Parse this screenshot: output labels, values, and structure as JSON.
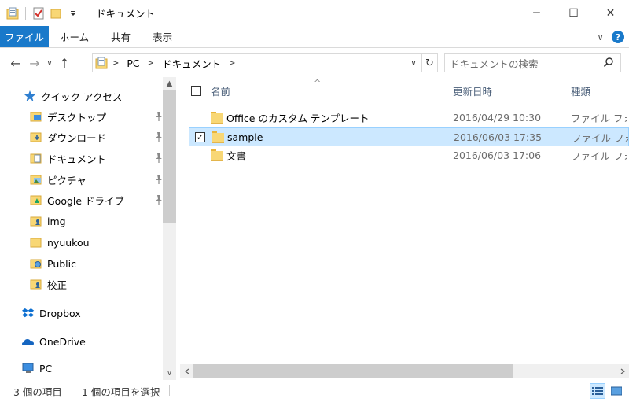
{
  "window": {
    "title": "ドキュメント",
    "minimize": "─",
    "maximize": "☐",
    "close": "✕"
  },
  "ribbon": {
    "tabs": [
      "ファイル",
      "ホーム",
      "共有",
      "表示"
    ],
    "expand": "∨",
    "help": "?"
  },
  "address": {
    "back": "←",
    "forward": "→",
    "recent": "∨",
    "up": "↑",
    "segments": [
      "PC",
      "ドキュメント"
    ],
    "separator": ">",
    "dropdown": "∨",
    "refresh": "↻"
  },
  "search": {
    "placeholder": "ドキュメントの検索"
  },
  "nav": {
    "quick_access": "クイック アクセス",
    "items": [
      {
        "label": "デスクトップ",
        "icon": "desktop-folder-icon",
        "pinned": true
      },
      {
        "label": "ダウンロード",
        "icon": "downloads-folder-icon",
        "pinned": true
      },
      {
        "label": "ドキュメント",
        "icon": "documents-folder-icon",
        "pinned": true
      },
      {
        "label": "ピクチャ",
        "icon": "pictures-folder-icon",
        "pinned": true
      },
      {
        "label": "Google ドライブ",
        "icon": "google-drive-folder-icon",
        "pinned": true
      },
      {
        "label": "img",
        "icon": "user-folder-icon",
        "pinned": false
      },
      {
        "label": "nyuukou",
        "icon": "folder-icon",
        "pinned": false
      },
      {
        "label": "Public",
        "icon": "public-folder-icon",
        "pinned": false
      },
      {
        "label": "校正",
        "icon": "user-folder-icon",
        "pinned": false
      }
    ],
    "dropbox": "Dropbox",
    "onedrive": "OneDrive",
    "pc": "PC",
    "scroll_up": "▲",
    "scroll_down": "∨"
  },
  "columns": {
    "name": "名前",
    "modified": "更新日時",
    "type": "種類",
    "sort_indicator": "^"
  },
  "files": [
    {
      "name": "Office のカスタム テンプレート",
      "modified": "2016/04/29 10:30",
      "type": "ファイル フォルダー",
      "selected": false
    },
    {
      "name": "sample",
      "modified": "2016/06/03 17:35",
      "type": "ファイル フォルダー",
      "selected": true
    },
    {
      "name": "文書",
      "modified": "2016/06/03 17:06",
      "type": "ファイル フォルダー",
      "selected": false
    }
  ],
  "checkmark": "✓",
  "status": {
    "count": "3 個の項目",
    "selected": "1 個の項目を選択"
  },
  "colors": {
    "accent": "#1979ca",
    "selection_bg": "#cce8ff",
    "selection_border": "#99d1ff",
    "folder": "#f8d775"
  }
}
